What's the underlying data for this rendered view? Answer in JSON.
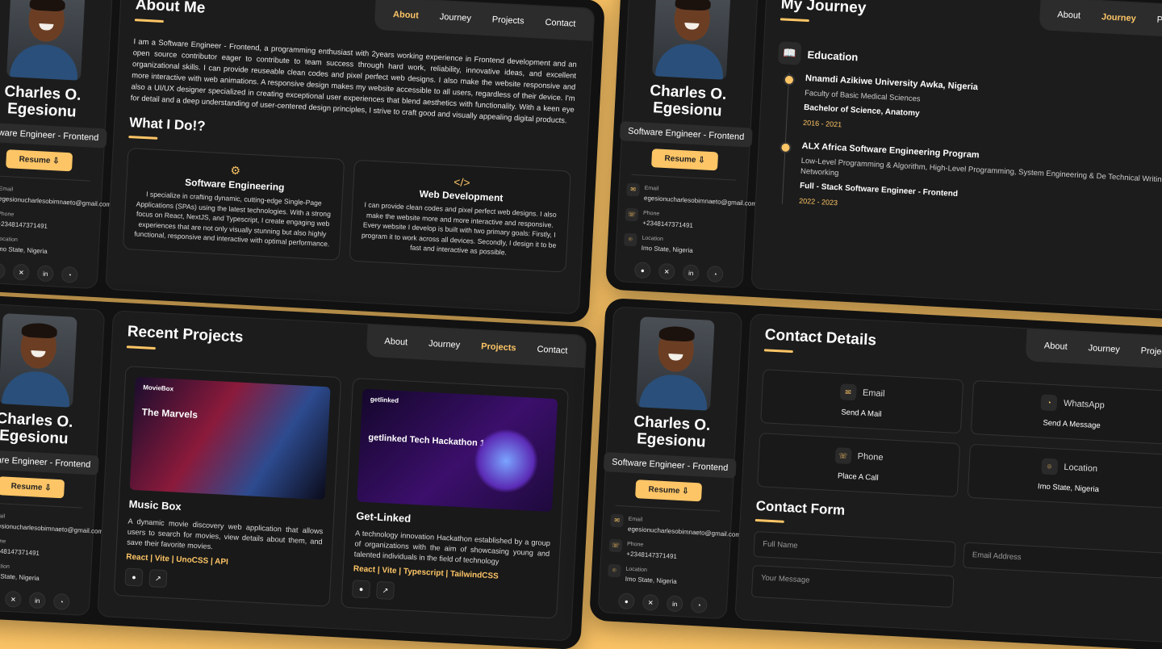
{
  "profile": {
    "name": "Charles O. Egesionu",
    "role": "Software Engineer - Frontend",
    "resume_label": "Resume",
    "email_label": "Email",
    "email": "egesionucharlesobimnaeto@gmail.com",
    "phone_label": "Phone",
    "phone": "+2348147371491",
    "location_label": "Location",
    "location": "Imo State, Nigeria",
    "socials": [
      "github-icon",
      "x-icon",
      "linkedin-icon",
      "whatsapp-icon"
    ]
  },
  "nav": {
    "about": "About",
    "journey": "Journey",
    "projects": "Projects",
    "contact": "Contact"
  },
  "about": {
    "title": "About Me",
    "text": "I am a Software Engineer - Frontend, a programming enthusiast with 2years working experience in Frontend development and an open source contributor eager to contribute to team success through hard work, reliability, innovative ideas, and excellent organizational skills. I can provide reuseable clean codes and pixel perfect web designs. I also make the website responsive and more interactive with web animations. A responsive design makes my website accessible to all users, regardless of their device. I'm also a UI/UX designer specialized in creating exceptional user experiences that blend aesthetics with functionality. With a keen eye for detail and a deep understanding of user-centered design principles, I strive to craft good and visually appealing digital products.",
    "what_title": "What I Do!?",
    "services": [
      {
        "icon": "gear-icon",
        "title": "Software Engineering",
        "desc": "I specialize in crafting dynamic, cutting-edge Single-Page Applications (SPAs) using the latest technologies. With a strong focus on React, NextJS, and Typescript, I create engaging web experiences that are not only visually stunning but also highly functional, responsive and interactive with optimal performance."
      },
      {
        "icon": "code-icon",
        "title": "Web Development",
        "desc": "I can provide clean codes and pixel perfect web designs. I also make the website more and more interactive and responsive. Every website I develop is built with two primary goals: Firstly, I program it to work across all devices. Secondly, I design it to be fast and interactive as possible."
      }
    ]
  },
  "journey": {
    "title": "My Journey",
    "education_title": "Education",
    "items": [
      {
        "school": "Nnamdi Azikiwe University Awka, Nigeria",
        "sub": "Faculty of Basic Medical Sciences",
        "degree": "Bachelor of Science, Anatomy",
        "date": "2016 - 2021"
      },
      {
        "school": "ALX Africa Software Engineering Program",
        "sub": "Low-Level Programming & Algorithm, High-Level Programming, System Engineering & De Technical Writing and Networking",
        "degree": "Full - Stack Software Engineer - Frontend",
        "date": "2022 - 2023"
      }
    ]
  },
  "projects": {
    "title": "Recent Projects",
    "items": [
      {
        "title": "Music Box",
        "desc": "A dynamic movie discovery web application that allows users to search for movies, view details about them, and save their favorite movies.",
        "stack": "React | Vite | UnoCSS | API",
        "shot_brand": "MovieBox",
        "shot_title": "The Marvels"
      },
      {
        "title": "Get-Linked",
        "desc": "A technology innovation Hackathon established by a group of organizations with the aim of showcasing young and talented individuals in the field of technology",
        "stack": "React | Vite | Typescript | TailwindCSS",
        "shot_brand": "getlinked",
        "shot_title": "getlinked Tech Hackathon 1.0"
      }
    ]
  },
  "contact": {
    "title": "Contact Details",
    "boxes": [
      {
        "icon": "mail-icon",
        "label": "Email",
        "value": "Send A Mail"
      },
      {
        "icon": "whatsapp-icon",
        "label": "WhatsApp",
        "value": "Send A Message"
      },
      {
        "icon": "phone-icon",
        "label": "Phone",
        "value": "Place A Call"
      },
      {
        "icon": "location-icon",
        "label": "Location",
        "value": "Imo State, Nigeria"
      }
    ],
    "form_title": "Contact Form",
    "full_name_placeholder": "Full Name",
    "email_placeholder": "Email Address",
    "message_placeholder": "Your Message"
  },
  "colors": {
    "accent": "#fdc566",
    "panel": "#121212",
    "card": "#1c1c1c"
  }
}
